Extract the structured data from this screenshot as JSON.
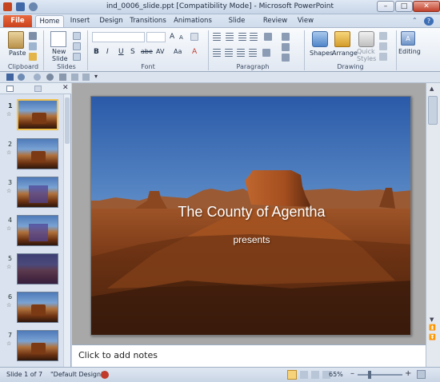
{
  "window": {
    "title": "ind_0006_slide.ppt [Compatibility Mode] - Microsoft PowerPoint",
    "minimize": "–",
    "maximize": "□",
    "close": "✕"
  },
  "tabs": [
    "File",
    "Home",
    "Insert",
    "Design",
    "Transitions",
    "Animations",
    "Slide Show",
    "Review",
    "View"
  ],
  "ribbon": {
    "clipboard": {
      "paste_label": "Paste",
      "group_label": "Clipboard"
    },
    "slides": {
      "new_slide_label": "New\nSlide",
      "group_label": "Slides"
    },
    "font": {
      "group_label": "Font",
      "bold": "B",
      "italic": "I",
      "underline": "U",
      "strike": "S",
      "shadow": "abe",
      "spacing": "AV",
      "case": "Aa",
      "grow": "A",
      "shrink": "A"
    },
    "paragraph": {
      "group_label": "Paragraph"
    },
    "drawing": {
      "group_label": "Drawing",
      "shapes_label": "Shapes",
      "arrange_label": "Arrange",
      "quick_styles_label": "Quick\nStyles"
    },
    "editing": {
      "label": "Editing"
    }
  },
  "slides_panel": {
    "slides": [
      {
        "number": "1",
        "selected": true,
        "style": "title"
      },
      {
        "number": "2",
        "selected": false,
        "style": "title"
      },
      {
        "number": "3",
        "selected": false,
        "style": "menu"
      },
      {
        "number": "4",
        "selected": false,
        "style": "menu"
      },
      {
        "number": "5",
        "selected": false,
        "style": "dark"
      },
      {
        "number": "6",
        "selected": false,
        "style": "title"
      },
      {
        "number": "7",
        "selected": false,
        "style": "title"
      }
    ],
    "close_icon": "✕"
  },
  "slide": {
    "title": "The County of Agentha",
    "subtitle": "presents"
  },
  "notes": {
    "placeholder": "Click to add notes"
  },
  "status": {
    "slide_info": "Slide 1 of 7",
    "theme": "\"Default Design\"",
    "zoom": "65%",
    "zoom_out": "–",
    "zoom_in": "+"
  }
}
